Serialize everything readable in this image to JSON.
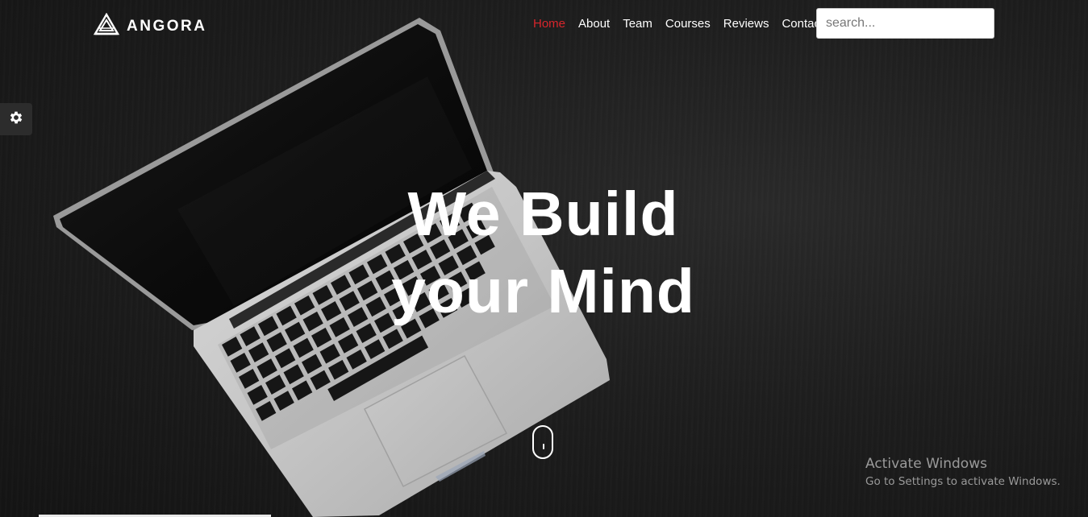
{
  "brand": {
    "name": "ANGORA",
    "icon": "logo-mark-icon"
  },
  "nav": {
    "items": [
      {
        "label": "Home",
        "active": true
      },
      {
        "label": "About",
        "active": false
      },
      {
        "label": "Team",
        "active": false
      },
      {
        "label": "Courses",
        "active": false
      },
      {
        "label": "Reviews",
        "active": false
      },
      {
        "label": "Contact",
        "active": false
      }
    ],
    "active_color": "#d8262c"
  },
  "search": {
    "placeholder": "search...",
    "value": ""
  },
  "settings": {
    "icon": "gear-icon"
  },
  "hero": {
    "line1": "We Build",
    "line2": "your Mind",
    "scroll_icon": "mouse-scroll-icon"
  },
  "watermark": {
    "title": "Activate Windows",
    "subtitle": "Go to Settings to activate Windows."
  }
}
